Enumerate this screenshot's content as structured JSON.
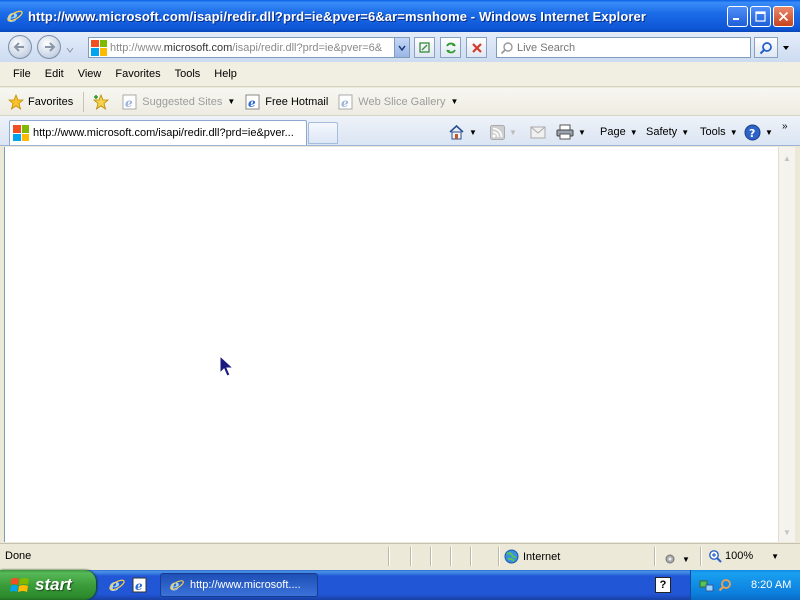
{
  "window": {
    "title": "http://www.microsoft.com/isapi/redir.dll?prd=ie&pver=6&ar=msnhome - Windows Internet Explorer"
  },
  "address": {
    "url_prefix": "http://www.",
    "url_domain": "microsoft.com",
    "url_rest": "/isapi/redir.dll?prd=ie&pver=6&"
  },
  "search": {
    "placeholder": "Live Search"
  },
  "menu": [
    "File",
    "Edit",
    "View",
    "Favorites",
    "Tools",
    "Help"
  ],
  "favorites_bar": {
    "favorites_label": "Favorites",
    "suggested_sites": "Suggested Sites",
    "free_hotmail": "Free Hotmail",
    "web_slice_gallery": "Web Slice Gallery"
  },
  "tab": {
    "title": "http://www.microsoft.com/isapi/redir.dll?prd=ie&pver..."
  },
  "commands": {
    "page": "Page",
    "safety": "Safety",
    "tools": "Tools"
  },
  "status": {
    "text": "Done",
    "zone": "Internet",
    "zoom": "100%"
  },
  "taskbar": {
    "start_label": "start",
    "task_title": "http://www.microsoft....",
    "help_glyph": "?",
    "clock": "8:20 AM"
  },
  "colors": {
    "titlebar": "#0e56d6",
    "start_green": "#3a9d3a",
    "taskbar_blue": "#2156d6",
    "tray_blue": "#0c7ddc"
  }
}
